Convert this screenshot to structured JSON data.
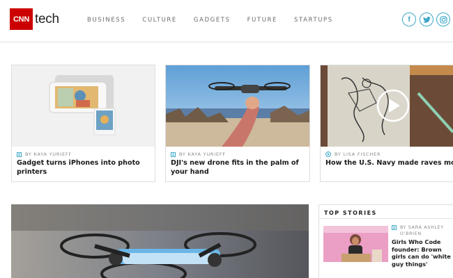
{
  "header": {
    "logo": {
      "brand": "CNN",
      "section": "tech"
    },
    "nav": [
      {
        "label": "BUSINESS"
      },
      {
        "label": "CULTURE"
      },
      {
        "label": "GADGETS"
      },
      {
        "label": "FUTURE"
      },
      {
        "label": "STARTUPS"
      }
    ],
    "social": [
      {
        "icon": "facebook-icon",
        "glyph": "f"
      },
      {
        "icon": "twitter-icon",
        "glyph": "t"
      },
      {
        "icon": "instagram-icon",
        "glyph": "◎"
      }
    ]
  },
  "cards": [
    {
      "byline": "BY KAYA YURIEFF",
      "title": "Gadget turns iPhones into photo printers",
      "type_icon": "article-icon"
    },
    {
      "byline": "BY KAYA YURIEFF",
      "title": "DJI's new drone fits in the palm of your hand",
      "type_icon": "article-icon"
    },
    {
      "byline": "BY LISA FISCHER",
      "title": "How the U.S. Navy made raves more fun",
      "type_icon": "video-icon"
    }
  ],
  "top_stories": {
    "heading": "TOP STORIES",
    "item": {
      "byline": "BY SARA ASHLEY O'BRIEN",
      "title": "Girls Who Code founder: Brown girls can do 'white guy things'",
      "type_icon": "article-icon"
    }
  },
  "colors": {
    "brand_red": "#cc0000",
    "accent_blue": "#3da7c7",
    "text": "#1a1a1a",
    "muted": "#888888"
  }
}
